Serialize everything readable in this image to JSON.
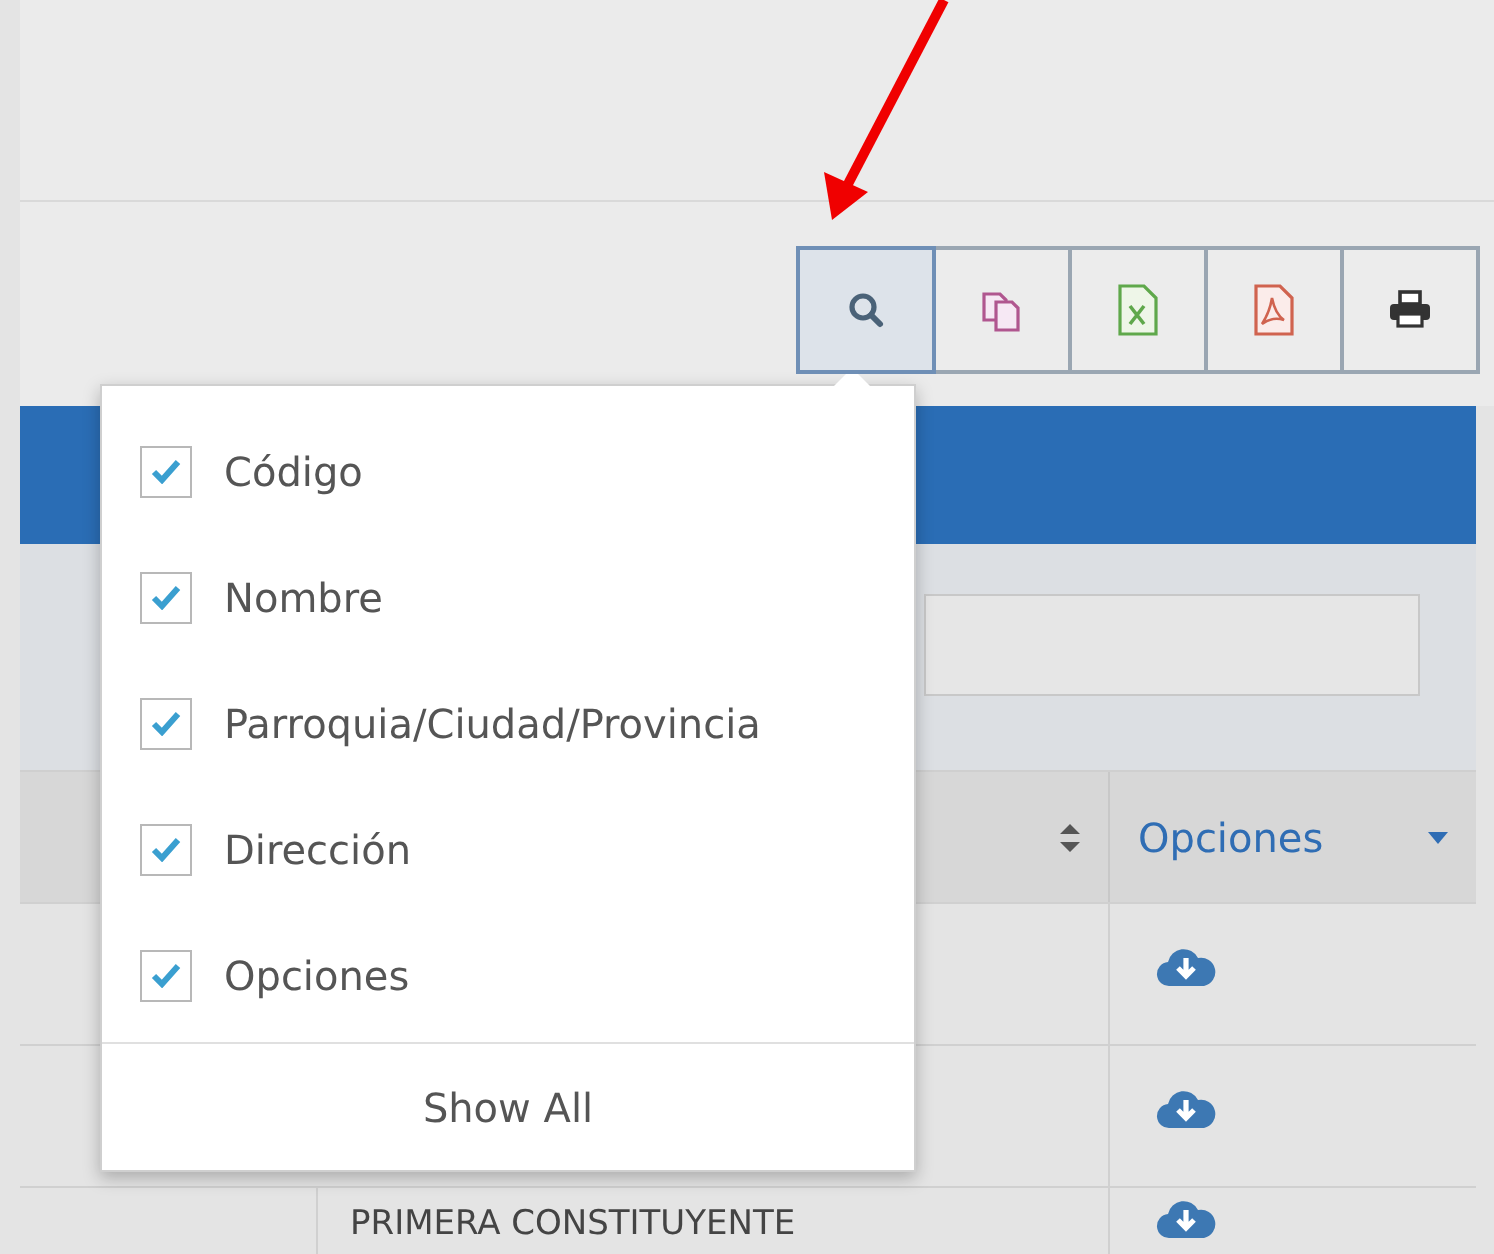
{
  "toolbar": {
    "buttons": [
      {
        "kind": "search",
        "selected": true
      },
      {
        "kind": "copy",
        "selected": false
      },
      {
        "kind": "excel",
        "selected": false
      },
      {
        "kind": "pdf",
        "selected": false
      },
      {
        "kind": "print",
        "selected": false
      }
    ]
  },
  "column_menu": {
    "items": [
      {
        "label": "Código",
        "checked": true
      },
      {
        "label": "Nombre",
        "checked": true
      },
      {
        "label": "Parroquia/Ciudad/Provincia",
        "checked": true
      },
      {
        "label": "Dirección",
        "checked": true
      },
      {
        "label": "Opciones",
        "checked": true
      }
    ],
    "show_all": "Show All"
  },
  "table": {
    "options_column": "Opciones",
    "rows": [
      {
        "kind": "covered"
      },
      {
        "kind": "covered"
      },
      {
        "kind": "text",
        "column_2": "PRIMERA CONSTITUYENTE"
      }
    ]
  }
}
